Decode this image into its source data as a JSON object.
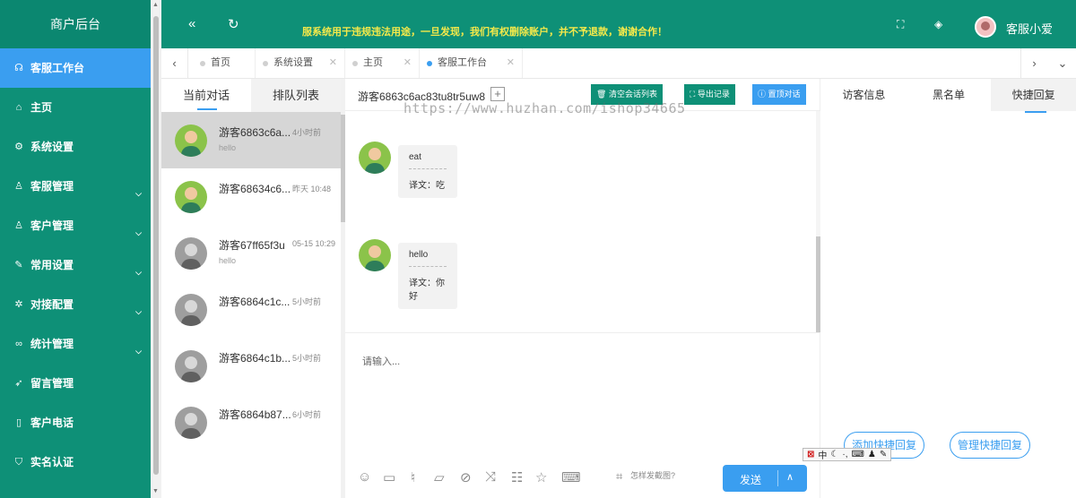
{
  "sidebar": {
    "brand": "商户后台",
    "items": [
      {
        "label": "客服工作台",
        "icon": "headset-icon",
        "glyph": "☊",
        "active": true,
        "chevron": false
      },
      {
        "label": "主页",
        "icon": "home-icon",
        "glyph": "⌂",
        "active": false,
        "chevron": false
      },
      {
        "label": "系统设置",
        "icon": "gear-icon",
        "glyph": "⚙",
        "active": false,
        "chevron": false
      },
      {
        "label": "客服管理",
        "icon": "user-icon",
        "glyph": "♙",
        "active": false,
        "chevron": true
      },
      {
        "label": "客户管理",
        "icon": "users-icon",
        "glyph": "♙",
        "active": false,
        "chevron": true
      },
      {
        "label": "常用设置",
        "icon": "edit-icon",
        "glyph": "✎",
        "active": false,
        "chevron": true
      },
      {
        "label": "对接配置",
        "icon": "plugin-icon",
        "glyph": "✲",
        "active": false,
        "chevron": true
      },
      {
        "label": "统计管理",
        "icon": "infinity-icon",
        "glyph": "∞",
        "active": false,
        "chevron": true
      },
      {
        "label": "留言管理",
        "icon": "send-icon",
        "glyph": "➶",
        "active": false,
        "chevron": false
      },
      {
        "label": "客户电话",
        "icon": "phone-icon",
        "glyph": "▯",
        "active": false,
        "chevron": false
      },
      {
        "label": "实名认证",
        "icon": "shield-check-icon",
        "glyph": "⛉",
        "active": false,
        "chevron": false
      }
    ]
  },
  "topbar": {
    "notice": "服系统用于违规违法用途，一旦发现，我们有权删除账户，并不予退款，谢谢合作！",
    "user_name": "客服小爱"
  },
  "tabs": [
    {
      "label": "首页",
      "closable": false,
      "active": false
    },
    {
      "label": "系统设置",
      "closable": true,
      "active": false
    },
    {
      "label": "主页",
      "closable": true,
      "active": false
    },
    {
      "label": "客服工作台",
      "closable": true,
      "active": true
    }
  ],
  "conversations": {
    "tab_current": "当前对话",
    "tab_queue": "排队列表",
    "items": [
      {
        "name": "游客6863c6a...",
        "time": "4小时前",
        "message": "hello",
        "active": true,
        "avatar": "green"
      },
      {
        "name": "游客68634c6...",
        "time": "昨天 10:48",
        "message": "",
        "active": false,
        "avatar": "green"
      },
      {
        "name": "游客67ff65f3u",
        "time": "05-15 10:29",
        "message": "hello",
        "active": false,
        "avatar": "grey"
      },
      {
        "name": "游客6864c1c...",
        "time": "5小时前",
        "message": "",
        "active": false,
        "avatar": "grey"
      },
      {
        "name": "游客6864c1b...",
        "time": "5小时前",
        "message": "",
        "active": false,
        "avatar": "grey"
      },
      {
        "name": "游客6864b87...",
        "time": "6小时前",
        "message": "",
        "active": false,
        "avatar": "grey"
      }
    ]
  },
  "chat": {
    "title": "游客6863c6ac83tu8tr5uw8",
    "btn_clear": "清空会话列表",
    "btn_export": "导出记录",
    "btn_pin": "置顶对话",
    "watermark": "https://www.huzhan.com/ishop34665",
    "messages": [
      {
        "text": "eat",
        "translation": "译文：吃"
      },
      {
        "text": "hello",
        "translation": "译文：你好"
      }
    ],
    "input_placeholder": "请输入...",
    "screenshot_hint": "怎样发截图?",
    "send_label": "发送"
  },
  "right_panel": {
    "tabs": [
      "访客信息",
      "黑名单",
      "快捷回复"
    ],
    "add_quick_reply": "添加快捷回复",
    "manage_quick_reply": "管理快捷回复"
  },
  "ime": {
    "label": "中"
  },
  "colors": {
    "brand_green": "#0e9077",
    "accent_blue": "#3a9ef0",
    "notice_yellow": "#f5e94a"
  }
}
